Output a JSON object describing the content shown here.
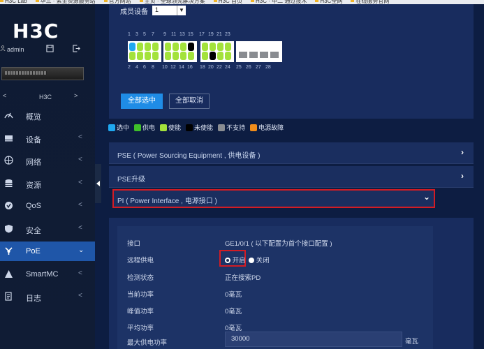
{
  "bookmarks": [
    "H3C Lab",
    "华三 · 紫金资源服务站",
    "官方网站",
    "主页 · 全球领先解决方案",
    "H3C 首页",
    "H3C · 中二 通过技术",
    "H3C全网",
    "在线服务官网"
  ],
  "sidebar": {
    "logo": "H3C",
    "user": "admin",
    "device_name": "H3C",
    "prev": "<",
    "next": ">",
    "items": [
      {
        "label": "概览",
        "icon": "dashboard-icon",
        "chev": ""
      },
      {
        "label": "设备",
        "icon": "device-icon",
        "chev": "<"
      },
      {
        "label": "网络",
        "icon": "globe-icon",
        "chev": "<"
      },
      {
        "label": "资源",
        "icon": "database-icon",
        "chev": "<"
      },
      {
        "label": "QoS",
        "icon": "qos-icon",
        "chev": "<"
      },
      {
        "label": "安全",
        "icon": "shield-icon",
        "chev": "<"
      },
      {
        "label": "PoE",
        "icon": "poe-icon",
        "chev": "⌄"
      },
      {
        "label": "SmartMC",
        "icon": "smartmc-icon",
        "chev": "<"
      },
      {
        "label": "日志",
        "icon": "log-icon",
        "chev": "<"
      }
    ]
  },
  "main": {
    "member_label": "成员设备",
    "member_value": "1",
    "top_nums": [
      "1",
      "3",
      "5",
      "7",
      "9",
      "11",
      "13",
      "15",
      "17",
      "19",
      "21",
      "23"
    ],
    "bottom_nums": [
      "2",
      "4",
      "6",
      "8",
      "10",
      "12",
      "14",
      "16",
      "18",
      "20",
      "22",
      "24",
      "25",
      "26",
      "27",
      "28"
    ],
    "select_all": "全部选中",
    "deselect_all": "全部取消",
    "legend": [
      {
        "label": "选中",
        "color": "#1fa8f0"
      },
      {
        "label": "供电",
        "color": "#3fbf2a"
      },
      {
        "label": "使能",
        "color": "#a3e23b"
      },
      {
        "label": "未使能",
        "color": "#000000"
      },
      {
        "label": "不支持",
        "color": "#8a8d92"
      },
      {
        "label": "电源故障",
        "color": "#f08c1a"
      }
    ],
    "accordion": [
      {
        "label": "PSE ( Power Sourcing Equipment , 供电设备 )"
      },
      {
        "label": "PSE升级"
      },
      {
        "label": "PI ( Power Interface , 电源接口 )"
      }
    ],
    "detail": {
      "interface_label": "接口",
      "interface_value": "GE1/0/1 ( 以下配置为首个接口配置 )",
      "remote_power_label": "远程供电",
      "on_label": "开启",
      "off_label": "关闭",
      "detect_label": "检测状态",
      "detect_value": "正在搜索PD",
      "current_label": "当前功率",
      "current_value": "0毫瓦",
      "peak_label": "峰值功率",
      "peak_value": "0毫瓦",
      "avg_label": "平均功率",
      "avg_value": "0毫瓦",
      "max_label": "最大供电功率",
      "max_value": "30000",
      "unit": "毫瓦"
    }
  }
}
